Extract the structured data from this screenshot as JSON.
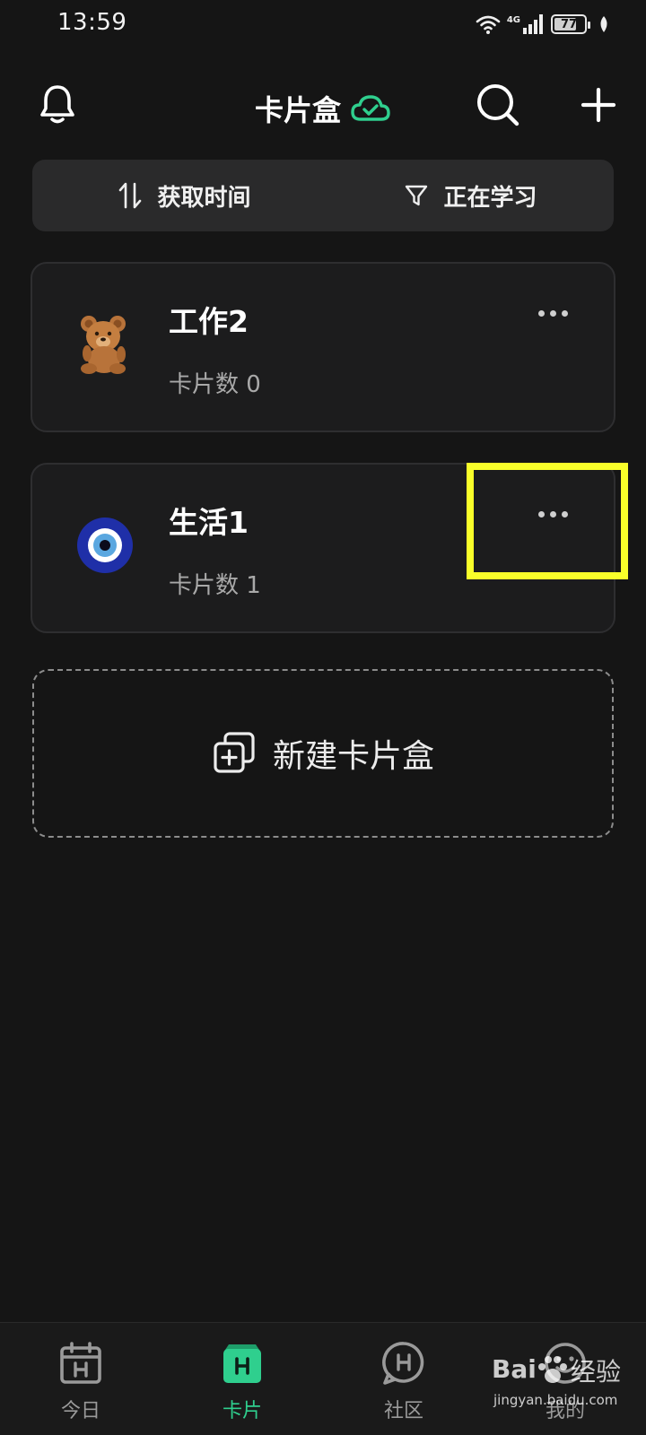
{
  "status_bar": {
    "time": "13:59",
    "network": "4G",
    "battery": 77
  },
  "header": {
    "title": "卡片盒",
    "sync_icon": "cloud-check-icon"
  },
  "filter_bar": {
    "sort_label": "获取时间",
    "filter_label": "正在学习"
  },
  "decks": [
    {
      "name": "工作2",
      "count_label": "卡片数 0",
      "avatar": "teddy-bear"
    },
    {
      "name": "生活1",
      "count_label": "卡片数 1",
      "avatar": "evil-eye"
    }
  ],
  "new_deck": {
    "label": "新建卡片盒"
  },
  "bottom_nav": [
    {
      "label": "今日",
      "icon": "calendar-h-icon",
      "active": false
    },
    {
      "label": "卡片",
      "icon": "card-box-h-icon",
      "active": true
    },
    {
      "label": "社区",
      "icon": "chat-h-icon",
      "active": false
    },
    {
      "label": "我的",
      "icon": "smile-face-icon",
      "active": false
    }
  ],
  "watermark": {
    "brand": "Bai",
    "brand_cn": "经验",
    "url": "jingyan.baidu.com"
  },
  "colors": {
    "accent": "#2fcf8e",
    "highlight": "#f8ff2a",
    "background": "#151515"
  }
}
